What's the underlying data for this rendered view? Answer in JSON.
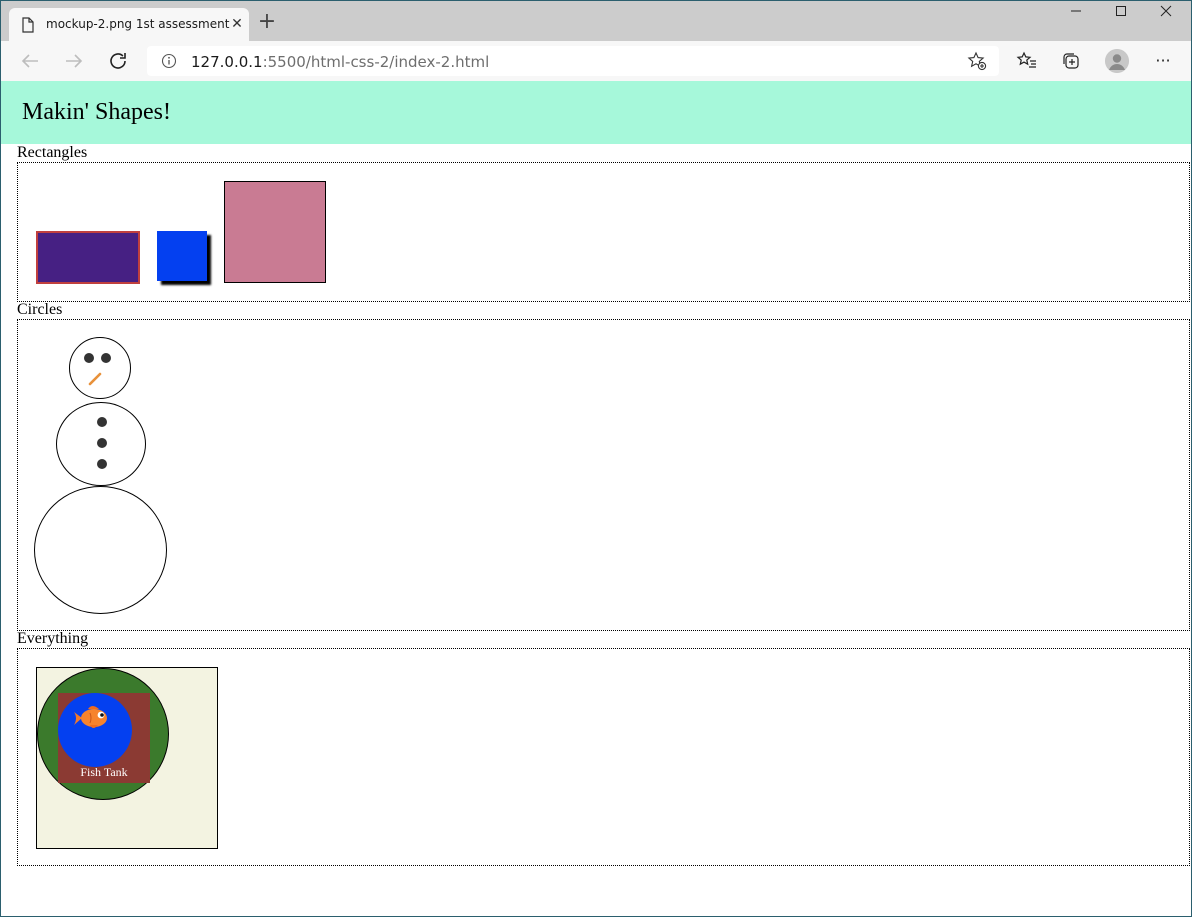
{
  "browser": {
    "tab_title": "mockup-2.png 1st assessment",
    "tab_close": "✕",
    "new_tab": "+",
    "url_host": "127.0.0.1",
    "url_rest": ":5500/html-css-2/index-2.html",
    "more": "···"
  },
  "page": {
    "title": "Makin' Shapes!",
    "sections": [
      {
        "label": "Rectangles"
      },
      {
        "label": "Circles"
      },
      {
        "label": "Everything"
      }
    ],
    "fish_tank_label": "Fish Tank"
  },
  "colors": {
    "header_bg": "#a6f8da",
    "rect_purple": "#462083",
    "rect_blue": "#0440f0",
    "rect_pink": "#c97b93",
    "tank_bg": "#f3f3e1",
    "tank_green": "#3b7a2c",
    "tank_red": "#8b3a33",
    "tank_blue": "#0440f0"
  }
}
